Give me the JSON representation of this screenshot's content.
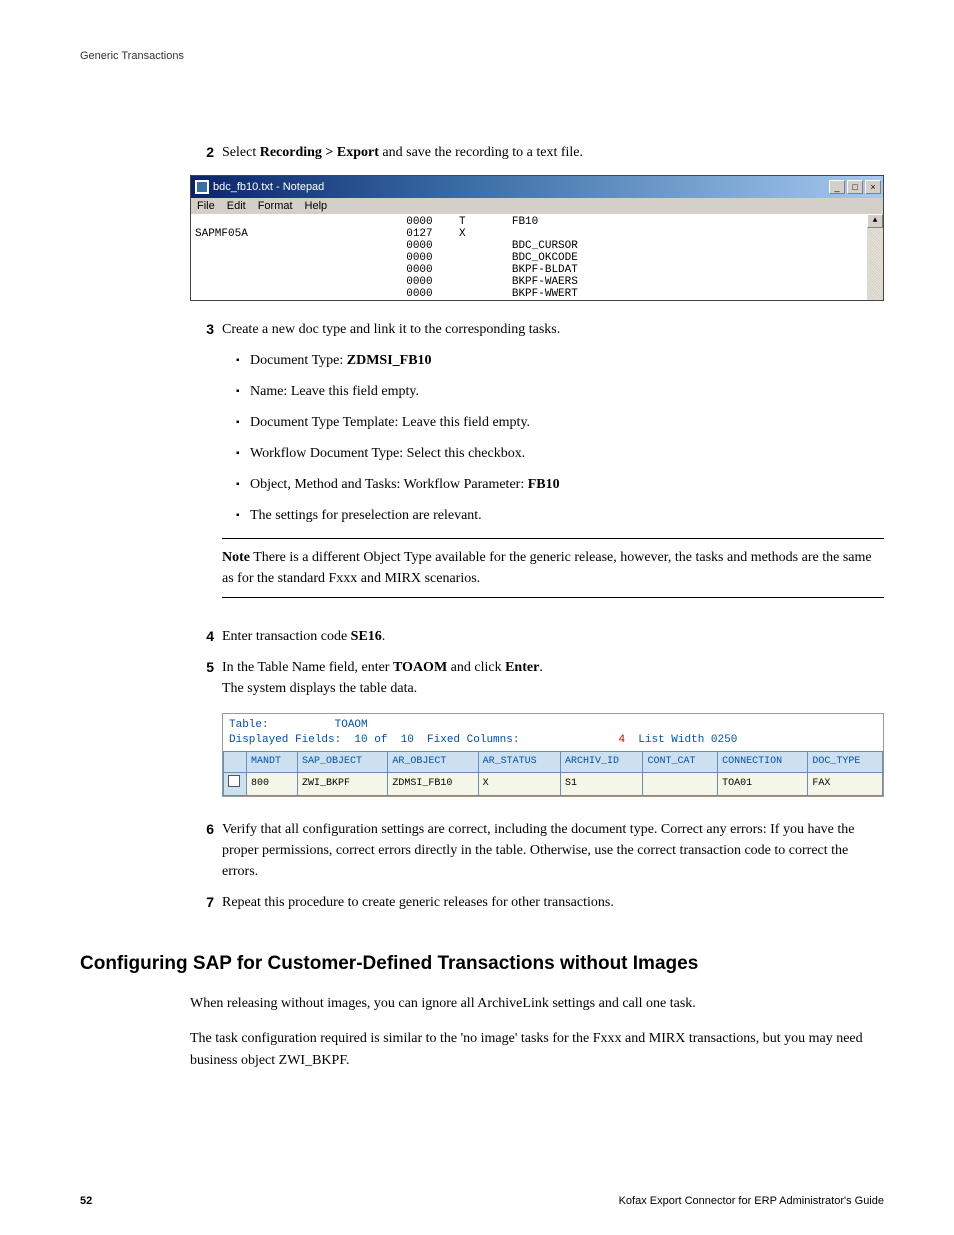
{
  "header": {
    "label": "Generic Transactions"
  },
  "step2": {
    "num": "2",
    "pre": "Select ",
    "bold": "Recording > Export",
    "post": " and save the recording to a text file."
  },
  "notepad": {
    "title": "bdc_fb10.txt - Notepad",
    "menus": [
      "File",
      "Edit",
      "Format",
      "Help"
    ],
    "btn_min": "_",
    "btn_max": "□",
    "btn_close": "×",
    "scroll_up": "▲",
    "text": "                                0000    T       FB10\nSAPMF05A                        0127    X\n                                0000            BDC_CURSOR\n                                0000            BDC_OKCODE\n                                0000            BKPF-BLDAT\n                                0000            BKPF-WAERS\n                                0000            BKPF-WWERT"
  },
  "step3": {
    "num": "3",
    "text": "Create a new doc type and link it to the corresponding tasks.",
    "bullets": [
      {
        "pre": "Document Type: ",
        "bold": "ZDMSI_FB10",
        "post": ""
      },
      {
        "pre": "Name: Leave this field empty.",
        "bold": "",
        "post": ""
      },
      {
        "pre": "Document Type Template: Leave this field empty.",
        "bold": "",
        "post": ""
      },
      {
        "pre": "Workflow Document Type: Select this checkbox.",
        "bold": "",
        "post": ""
      },
      {
        "pre": "Object, Method and Tasks: Workflow Parameter: ",
        "bold": "FB10",
        "post": ""
      },
      {
        "pre": "The settings for preselection are relevant.",
        "bold": "",
        "post": ""
      }
    ]
  },
  "note": {
    "label": "Note",
    "text": "  There is a different Object Type available for the generic release, however, the tasks and methods are the same as for the standard Fxxx and MIRX scenarios."
  },
  "step4": {
    "num": "4",
    "pre": "Enter transaction code ",
    "bold": "SE16",
    "post": "."
  },
  "step5": {
    "num": "5",
    "pre": "In the Table Name field, enter ",
    "bold1": "TOAOM",
    "mid": " and click ",
    "bold2": "Enter",
    "post": ".",
    "line2": "The system displays the table data."
  },
  "sap": {
    "line1_lbl": "Table:          ",
    "line1_val": "TOAOM",
    "line2_a": "Displayed Fields:  10 of  10  Fixed Columns:",
    "line2_b": "4",
    "line2_c": "  List Width 0250",
    "headers": [
      "MANDT",
      "SAP_OBJECT",
      "AR_OBJECT",
      "AR_STATUS",
      "ARCHIV_ID",
      "CONT_CAT",
      "CONNECTION",
      "DOC_TYPE"
    ],
    "row": [
      "800",
      "ZWI_BKPF",
      "ZDMSI_FB10",
      "X",
      "S1",
      "",
      "TOA01",
      "FAX"
    ]
  },
  "step6": {
    "num": "6",
    "text": "Verify that all configuration settings are correct, including the document type. Correct any errors: If you have the proper permissions, correct errors directly in the table. Otherwise, use the correct transaction code to correct the errors."
  },
  "step7": {
    "num": "7",
    "text": "Repeat this procedure to create generic releases for other transactions."
  },
  "section": {
    "title": "Configuring SAP for Customer-Defined Transactions without Images"
  },
  "para1": "When releasing without images, you can ignore all ArchiveLink settings and call one task.",
  "para2": "The task configuration required is similar to the 'no image' tasks for the Fxxx and MIRX transactions, but you may need business object ZWI_BKPF.",
  "footer": {
    "page": "52",
    "guide": "Kofax Export Connector for ERP Administrator's Guide"
  }
}
